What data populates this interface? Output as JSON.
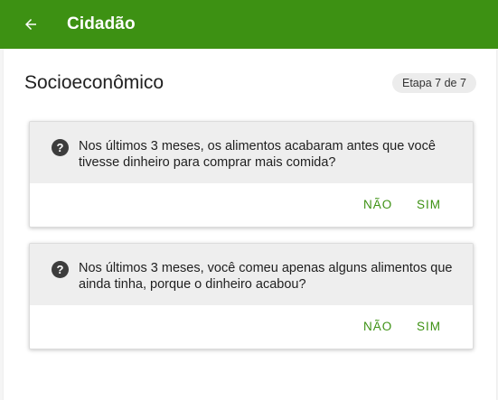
{
  "app_bar": {
    "title": "Cidadão",
    "back_icon": "arrow-left-icon",
    "color": "#3d9113"
  },
  "section": {
    "title": "Socioeconômico",
    "step": "Etapa 7 de 7"
  },
  "questions": [
    {
      "icon": "help-circle-icon",
      "text": "Nos últimos 3 meses, os alimentos acabaram antes que você tivesse dinheiro para comprar mais comida?",
      "no_label": "NÃO",
      "yes_label": "SIM"
    },
    {
      "icon": "help-circle-icon",
      "text": "Nos últimos 3 meses, você comeu apenas alguns alimentos que ainda tinha, porque o dinheiro acabou?",
      "no_label": "NÃO",
      "yes_label": "SIM"
    }
  ],
  "accent_color": "#3d9113"
}
